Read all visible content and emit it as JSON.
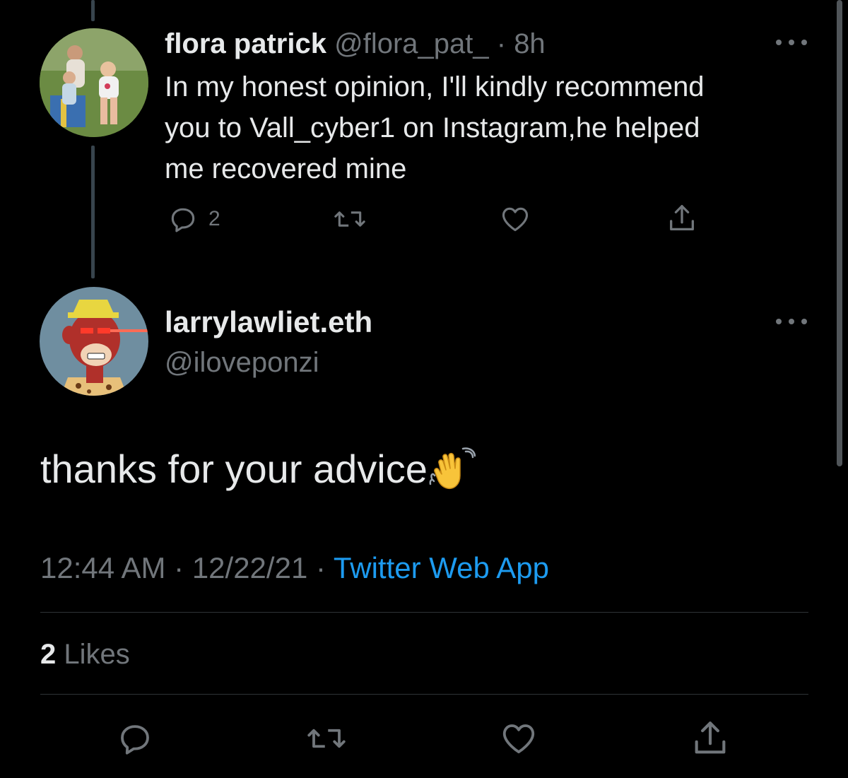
{
  "reply": {
    "author_name": "flora patrick",
    "author_handle": "@flora_pat_",
    "separator": "·",
    "time_ago": "8h",
    "text": "In my honest opinion, I'll kindly recommend\nyou to Vall_cyber1 on Instagram,he helped\nme recovered mine",
    "reply_count": "2",
    "icons": [
      "reply-icon",
      "retweet-icon",
      "like-icon",
      "share-icon",
      "more-icon"
    ]
  },
  "main_tweet": {
    "author_name": "larrylawliet.eth",
    "author_handle": "@iloveponzi",
    "text": "thanks for your advice",
    "emoji": "waving-hand-icon",
    "time": "12:44 AM",
    "date": "12/22/21",
    "separator": "·",
    "source": "Twitter Web App",
    "likes_count": "2",
    "likes_label": "Likes",
    "icons": [
      "reply-icon",
      "retweet-icon",
      "like-icon",
      "share-icon",
      "more-icon"
    ]
  },
  "colors": {
    "background": "#000000",
    "text_primary": "#e7e9ea",
    "text_secondary": "#71767b",
    "link": "#1d9bf0",
    "divider": "#2f3336",
    "thread_line": "#38444d"
  }
}
